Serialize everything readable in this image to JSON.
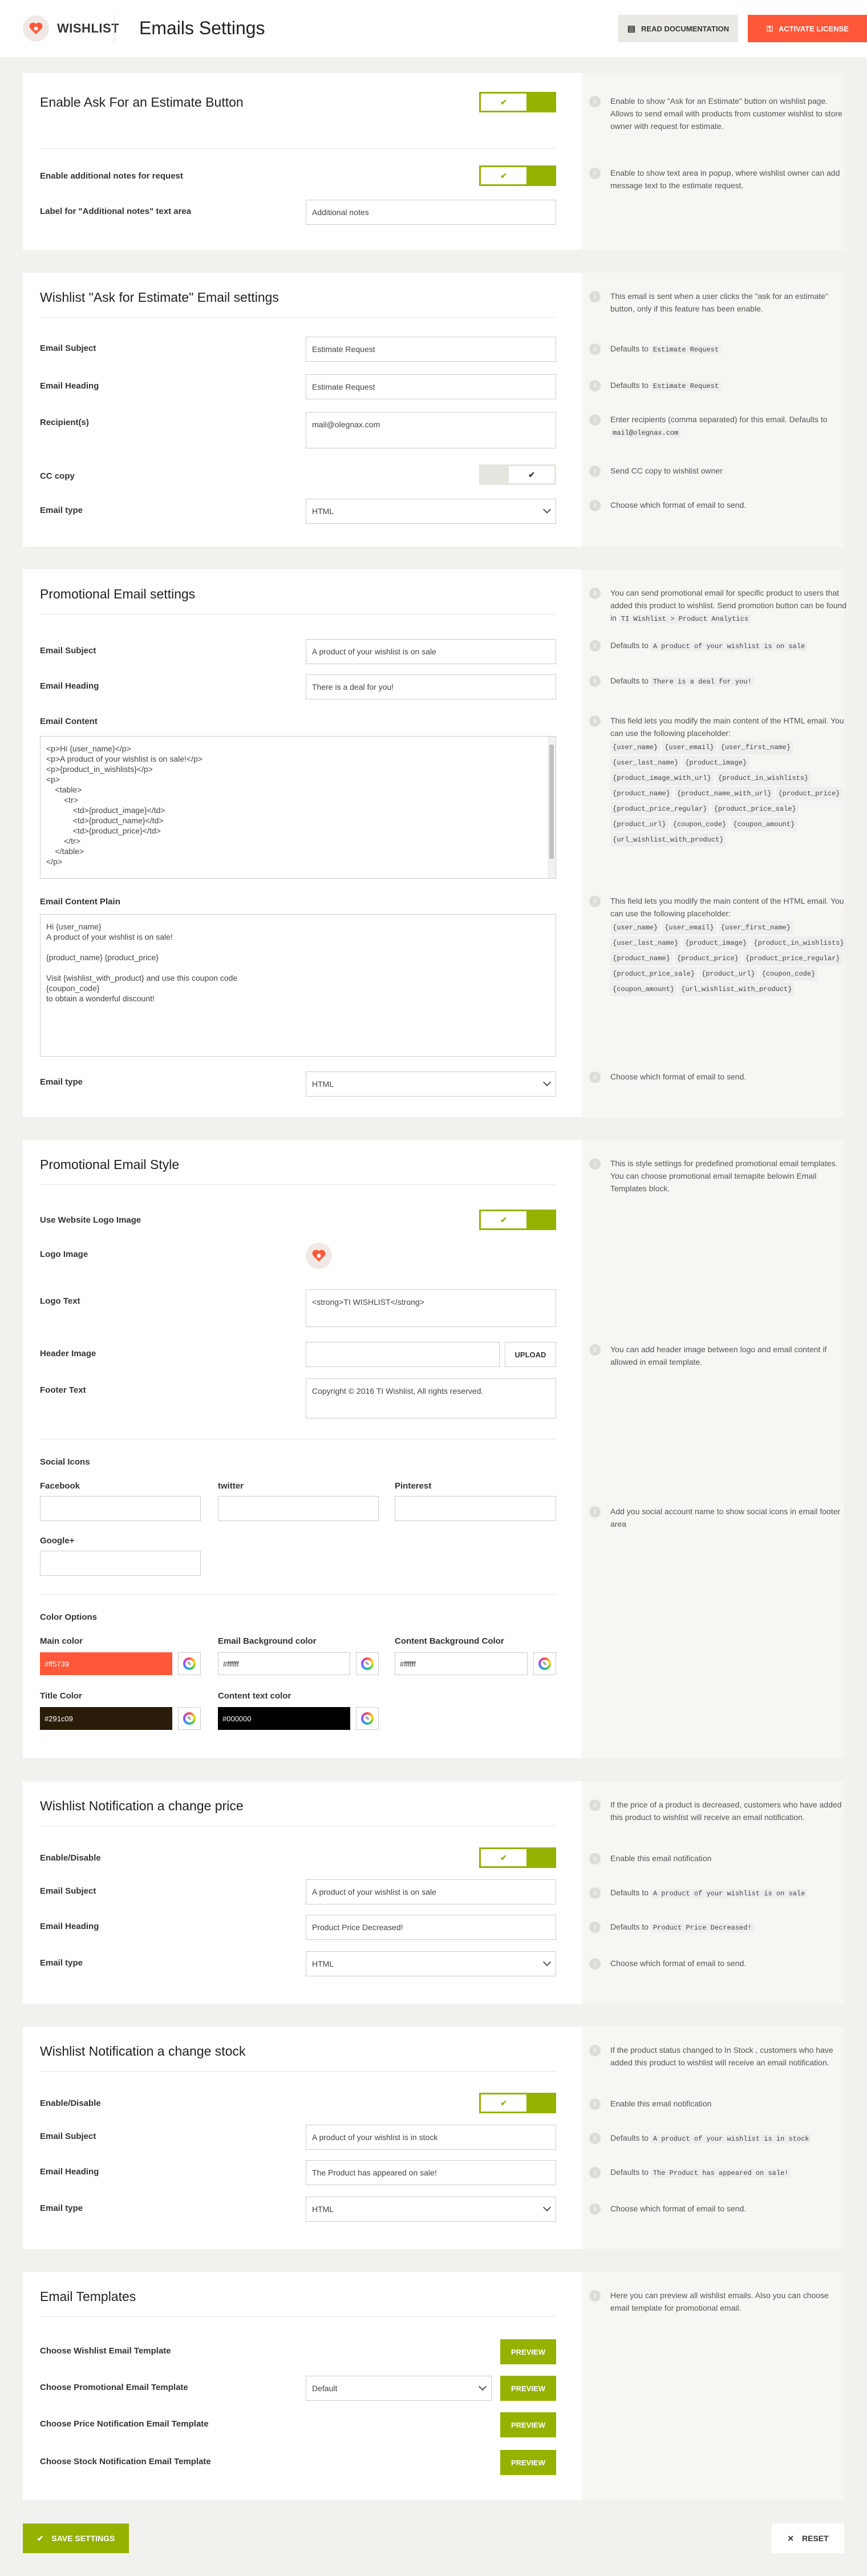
{
  "header": {
    "logo": "WISHLIST",
    "title": "Emails Settings",
    "doc_btn": "READ DOCUMENTATION",
    "license_btn": "ACTIVATE LICENSE"
  },
  "estimate": {
    "title": "Enable Ask For an Estimate Button",
    "enable_toggle": "on",
    "notes_label": "Enable additional notes for request",
    "notes_toggle": "on",
    "notes_text_label": "Label for \"Additional notes\" text area",
    "notes_text_value": "Additional notes",
    "note1": "Enable to show \"Ask for an Estimate\" button on wishlist page. Allows to send email with products from customer wishlist to store owner with request for estimate.",
    "note2": "Enable to show text area in popup, where wishlist owner can add message text to the estimate request."
  },
  "estimate_email": {
    "title": "Wishlist \"Ask for Estimate\" Email settings",
    "subject_label": "Email Subject",
    "subject_value": "Estimate Request",
    "heading_label": "Email Heading",
    "heading_value": "Estimate Request",
    "recipients_label": "Recipient(s)",
    "recipients_value": "mail@olegnax.com",
    "cc_label": "CC copy",
    "cc_toggle": "off",
    "type_label": "Email type",
    "type_value": "HTML",
    "note_intro": "This email is sent when a user clicks the \"ask for an estimate\" button, only if this feature has been enable.",
    "note_subject_pre": "Defaults to",
    "note_subject_code": "Estimate Request",
    "note_heading_pre": "Defaults to",
    "note_heading_code": "Estimate Request",
    "note_recip_pre": "Enter recipients (comma separated) for this email. Defaults to",
    "note_recip_code": "mail@olegnax.com",
    "note_cc": "Send CC copy to wishlist owner",
    "note_type": "Choose which format of email to send."
  },
  "promo_email": {
    "title": "Promotional Email settings",
    "subject_label": "Email Subject",
    "subject_value": "A product of your wishlist is on sale",
    "heading_label": "Email Heading",
    "heading_value": "There is a deal for you!",
    "content_label": "Email Content",
    "content_value": "<p>Hi {user_name}</p>\n<p>A product of your wishlist is on sale!</p>\n<p>{product_in_wishlists}</p>\n<p>\n    <table>\n        <tr>\n            <td>{product_image}</td>\n            <td>{product_name}</td>\n            <td>{product_price}</td>\n        </tr>\n    </table>\n</p>",
    "plain_label": "Email Content Plain",
    "plain_value": "Hi {user_name}\nA product of your wishlist is on sale!\n\n{product_name} {product_price}\n\nVisit {wishlist_with_product} and use this coupon code\n{coupon_code}\nto obtain a wonderful discount!",
    "type_label": "Email type",
    "type_value": "HTML",
    "note_intro_pre": "You can send promotional email for specific product to users that added this product to wishlist. Send promotion button can be found in",
    "note_intro_code": "TI Wishlist > Product Analytics",
    "note_subject_pre": "Defaults to",
    "note_subject_code": "A product of your wishlist is on sale",
    "note_heading_pre": "Defaults to",
    "note_heading_code": "There is a deal for you!",
    "note_content": "This field lets you modify the main content of the HTML email. You can use the following placeholder:",
    "content_placeholders": [
      "{user_name}",
      "{user_email}",
      "{user_first_name}",
      "{user_last_name}",
      "{product_image}",
      "{product_image_with_url}",
      "{product_in_wishlists}",
      "{product_name}",
      "{product_name_with_url}",
      "{product_price}",
      "{product_price_regular}",
      "{product_price_sale}",
      "{product_url}",
      "{coupon_code}",
      "{coupon_amount}",
      "{url_wishlist_with_product}"
    ],
    "note_plain": "This field lets you modify the main content of the HTML email. You can use the following placeholder:",
    "plain_placeholders": [
      "{user_name}",
      "{user_email}",
      "{user_first_name}",
      "{user_last_name}",
      "{product_image}",
      "{product_in_wishlists}",
      "{product_name}",
      "{product_price}",
      "{product_price_regular}",
      "{product_price_sale}",
      "{product_url}",
      "{coupon_code}",
      "{coupon_amount}",
      "{url_wishlist_with_product}"
    ],
    "note_type": "Choose which format of email to send."
  },
  "style": {
    "title": "Promotional Email Style",
    "use_logo_label": "Use Website Logo Image",
    "use_logo_toggle": "on",
    "logo_image_label": "Logo Image",
    "logo_text_label": "Logo Text",
    "logo_text_value": "<strong>TI WISHLIST</strong>",
    "header_image_label": "Header Image",
    "upload_btn": "UPLOAD",
    "footer_label": "Footer Text",
    "footer_value": "Copyright © 2016 TI Wishlist, All rights reserved.",
    "social_title": "Social Icons",
    "facebook": "Facebook",
    "twitter": "twitter",
    "pinterest": "Pinterest",
    "googleplus": "Google+",
    "colors_title": "Color Options",
    "main_color_label": "Main color",
    "main_color": "#ff5739",
    "email_bg_label": "Email Background color",
    "email_bg": "#ffffff",
    "content_bg_label": "Content Background Color",
    "content_bg": "#ffffff",
    "title_color_label": "Title Color",
    "title_color": "#291c09",
    "text_color_label": "Content text color",
    "text_color": "#000000",
    "note_intro": "This is style settings for predefined promotional email templates. You can choose promotional email temapite belowin Email Templates block.",
    "note_header": "You can add header image between logo and email content if allowed in email template.",
    "note_social": "Add you social account name to show social icons in email footer area"
  },
  "price_notif": {
    "title": "Wishlist Notification a change price",
    "enable_label": "Enable/Disable",
    "enable_toggle": "on",
    "subject_label": "Email Subject",
    "subject_value": "A product of your wishlist is on sale",
    "heading_label": "Email Heading",
    "heading_value": "Product Price Decreased!",
    "type_label": "Email type",
    "type_value": "HTML",
    "note_intro": "If the price of a product is decreased, customers who have added this product to wishlist will receive an email notification.",
    "note_enable": "Enable this email notification",
    "note_subject_pre": "Defaults to",
    "note_subject_code": "A product of your wishlist is on sale",
    "note_heading_pre": "Defaults to",
    "note_heading_code": "Product Price Decreased!",
    "note_type": "Choose which format of email to send."
  },
  "stock_notif": {
    "title": "Wishlist Notification a change stock",
    "enable_label": "Enable/Disable",
    "enable_toggle": "on",
    "subject_label": "Email Subject",
    "subject_value": "A product of your wishlist is in stock",
    "heading_label": "Email Heading",
    "heading_value": "The Product has appeared on sale!",
    "type_label": "Email type",
    "type_value": "HTML",
    "note_intro": "If the product status changed to In Stock , customers who have added this product to wishlist will receive an email notification.",
    "note_enable": "Enable this email notification",
    "note_subject_pre": "Defaults to",
    "note_subject_code": "A product of your wishlist is in stock",
    "note_heading_pre": "Defaults to",
    "note_heading_code": "The Product has appeared on sale!",
    "note_type": "Choose which format of email to send."
  },
  "templates": {
    "title": "Email Templates",
    "wishlist_label": "Choose Wishlist Email Template",
    "promo_label": "Choose Promotional Email Template",
    "promo_value": "Default",
    "price_label": "Choose Price Notification Email Template",
    "stock_label": "Choose Stock Notification Email Template",
    "preview_btn": "PREVIEW",
    "note": "Here you can preview all wishlist emails. Also you can choose email template for promotional email."
  },
  "footer": {
    "save": "SAVE SETTINGS",
    "reset": "RESET"
  },
  "colors": {
    "accent": "#96b100",
    "brand": "#ff5739"
  }
}
